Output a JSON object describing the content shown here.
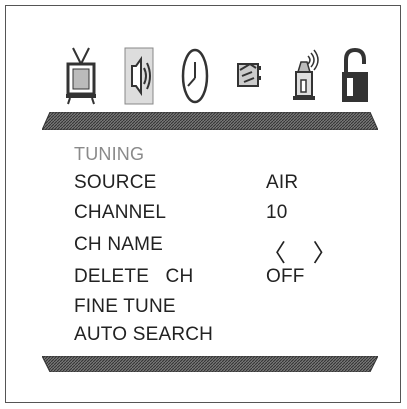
{
  "menu": {
    "title": "TUNING",
    "items": [
      {
        "label": "SOURCE",
        "value": "AIR"
      },
      {
        "label": "CHANNEL",
        "value": "10"
      },
      {
        "label": "CH NAME",
        "value": "〈 〉"
      },
      {
        "label": "DELETE   CH",
        "value": "OFF"
      },
      {
        "label": "FINE TUNE",
        "value": ""
      },
      {
        "label": "AUTO SEARCH",
        "value": ""
      }
    ]
  },
  "icons": [
    "tv-icon",
    "speaker-icon",
    "clock-icon",
    "hand-pointer-icon",
    "tower-antenna-icon",
    "padlock-icon"
  ],
  "colors": {
    "hatch": "#555555",
    "title": "#8a8a8a",
    "text": "#222222"
  }
}
